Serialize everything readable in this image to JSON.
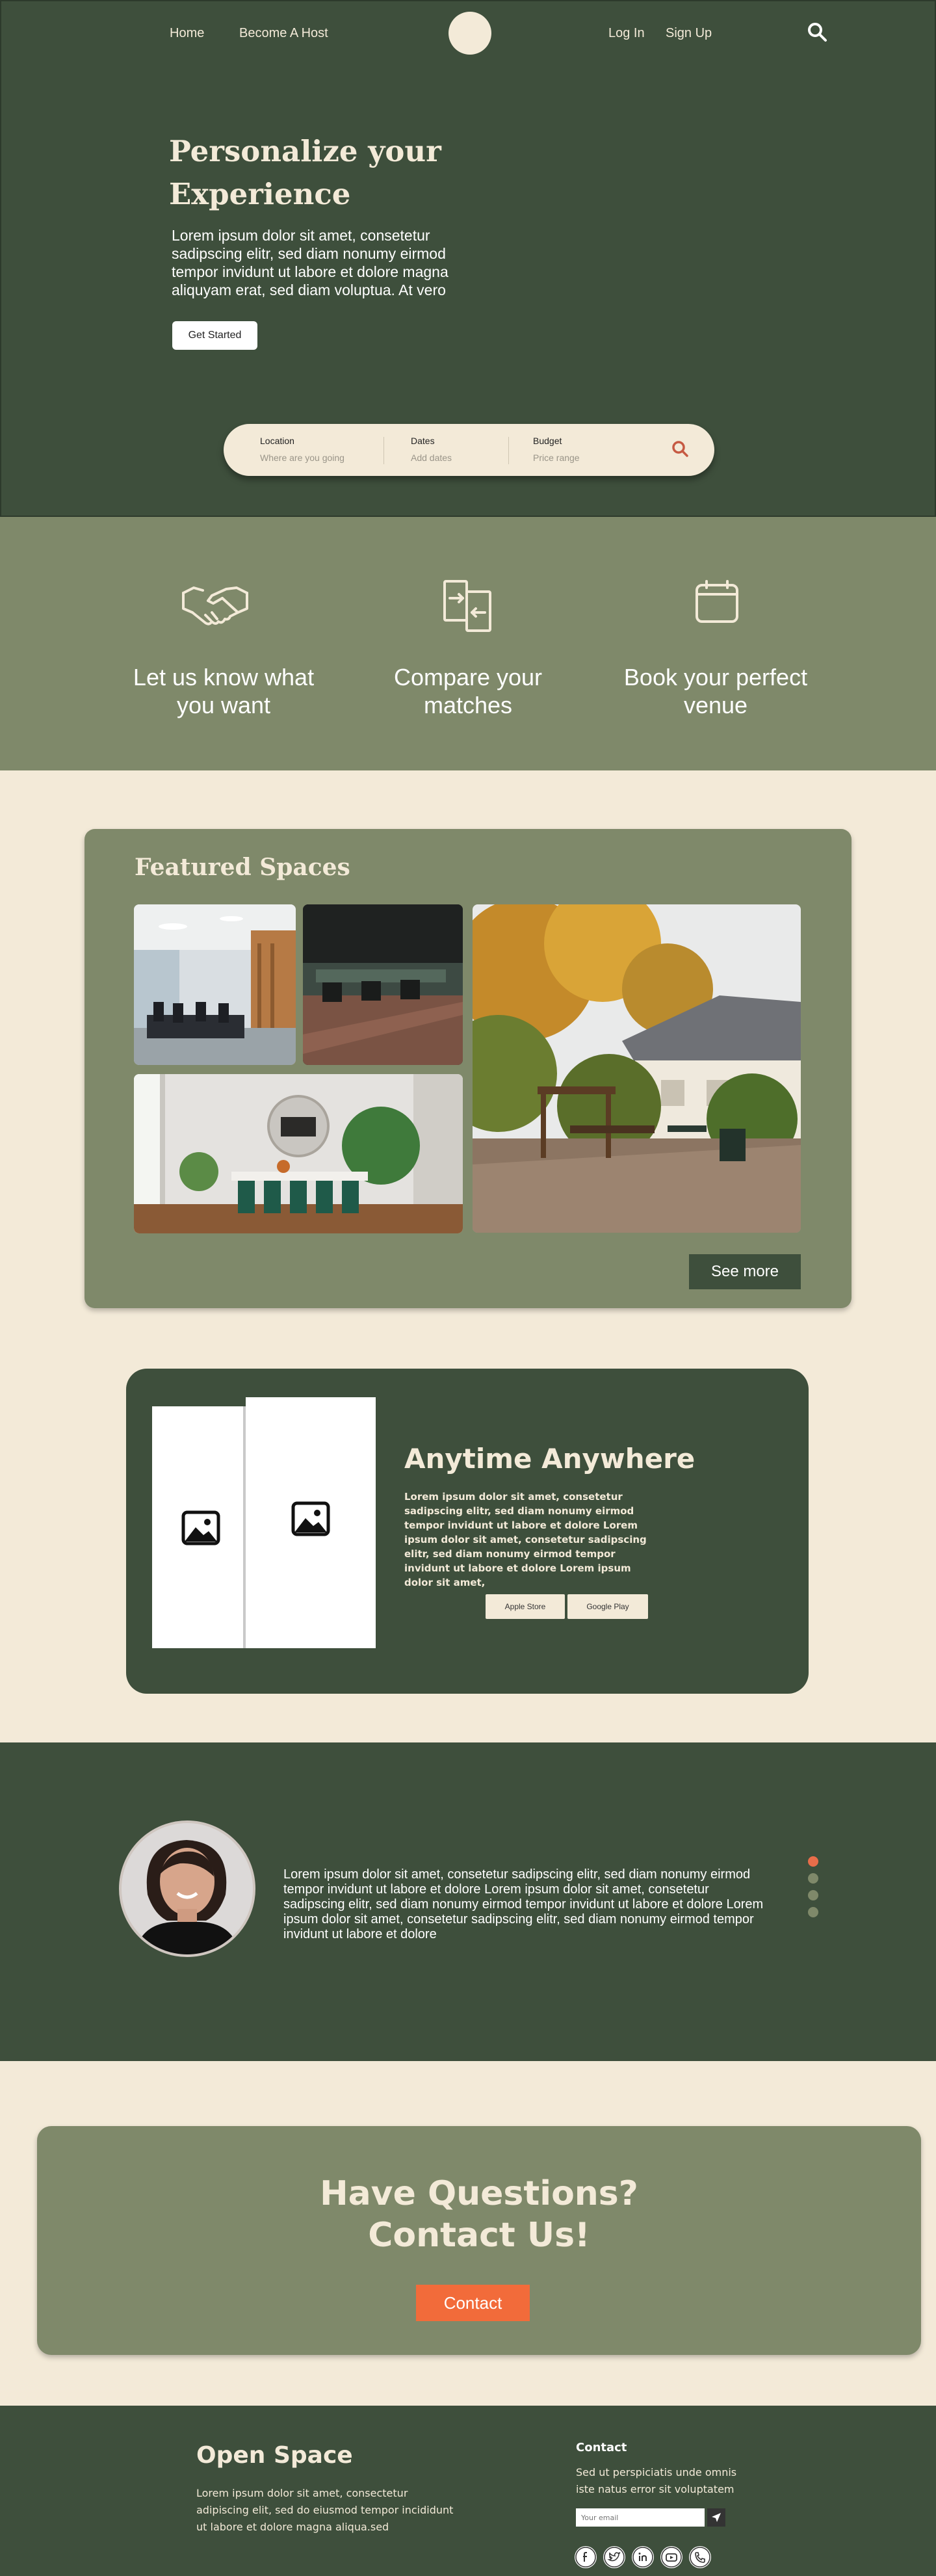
{
  "nav": {
    "home": "Home",
    "become_host": "Become A Host",
    "login": "Log In",
    "signup": "Sign Up"
  },
  "hero": {
    "title": "Personalize your Experience",
    "text": "Lorem ipsum dolor sit amet, consetetur sadipscing elitr, sed diam nonumy eirmod tempor invidunt ut labore et dolore magna aliquyam erat, sed diam voluptua. At vero",
    "cta": "Get Started"
  },
  "search": {
    "location_label": "Location",
    "location_placeholder": "Where are you going",
    "dates_label": "Dates",
    "dates_placeholder": "Add dates",
    "budget_label": "Budget",
    "budget_placeholder": "Price range"
  },
  "steps": [
    {
      "text": "Let us know what you want",
      "icon": "handshake-icon"
    },
    {
      "text": "Compare your matches",
      "icon": "compare-icon"
    },
    {
      "text": "Book your perfect venue",
      "icon": "calendar-icon"
    }
  ],
  "featured": {
    "title": "Featured Spaces",
    "see_more": "See more"
  },
  "app": {
    "title": "Anytime Anywhere",
    "text": "Lorem ipsum dolor sit amet, consetetur sadipscing elitr, sed diam  nonumy eirmod tempor invidunt ut labore et dolore Lorem ipsum dolor sit amet, consetetur sadipscing elitr, sed diam nonumy eirmod tempor invidunt ut labore et dolore Lorem ipsum dolor sit amet,",
    "apple_store": "Apple Store",
    "google_play": "Google Play"
  },
  "testimonial": {
    "text": "Lorem ipsum dolor sit amet, consetetur sadipscing elitr, sed diam  nonumy eirmod tempor invidunt ut labore et dolore Lorem ipsum dolor sit amet, consetetur sadipscing elitr, sed diam nonumy eirmod tempor invidunt ut labore et dolore Lorem ipsum dolor sit amet, consetetur sadipscing elitr, sed diam nonumy eirmod tempor invidunt ut labore et dolore",
    "active_slide": 1,
    "slide_count": 4
  },
  "contact": {
    "title_line1": "Have Questions?",
    "title_line2": "Contact Us!",
    "button": "Contact"
  },
  "footer": {
    "brand": "Open Space",
    "text": "Lorem ipsum dolor sit amet, consectetur adipiscing elit, sed do eiusmod tempor incididunt ut labore et dolore magna aliqua.sed",
    "contact_title": "Contact",
    "contact_text": "Sed ut perspiciatis unde omnis iste natus error sit voluptatem",
    "email_placeholder": "Your email",
    "socials": [
      "facebook-icon",
      "twitter-icon",
      "linkedin-icon",
      "youtube-icon",
      "phone-icon"
    ]
  },
  "colors": {
    "dark_green": "#3e4f3c",
    "sage": "#7f896a",
    "cream": "#f3ead8",
    "accent_orange": "#f26b3a"
  }
}
